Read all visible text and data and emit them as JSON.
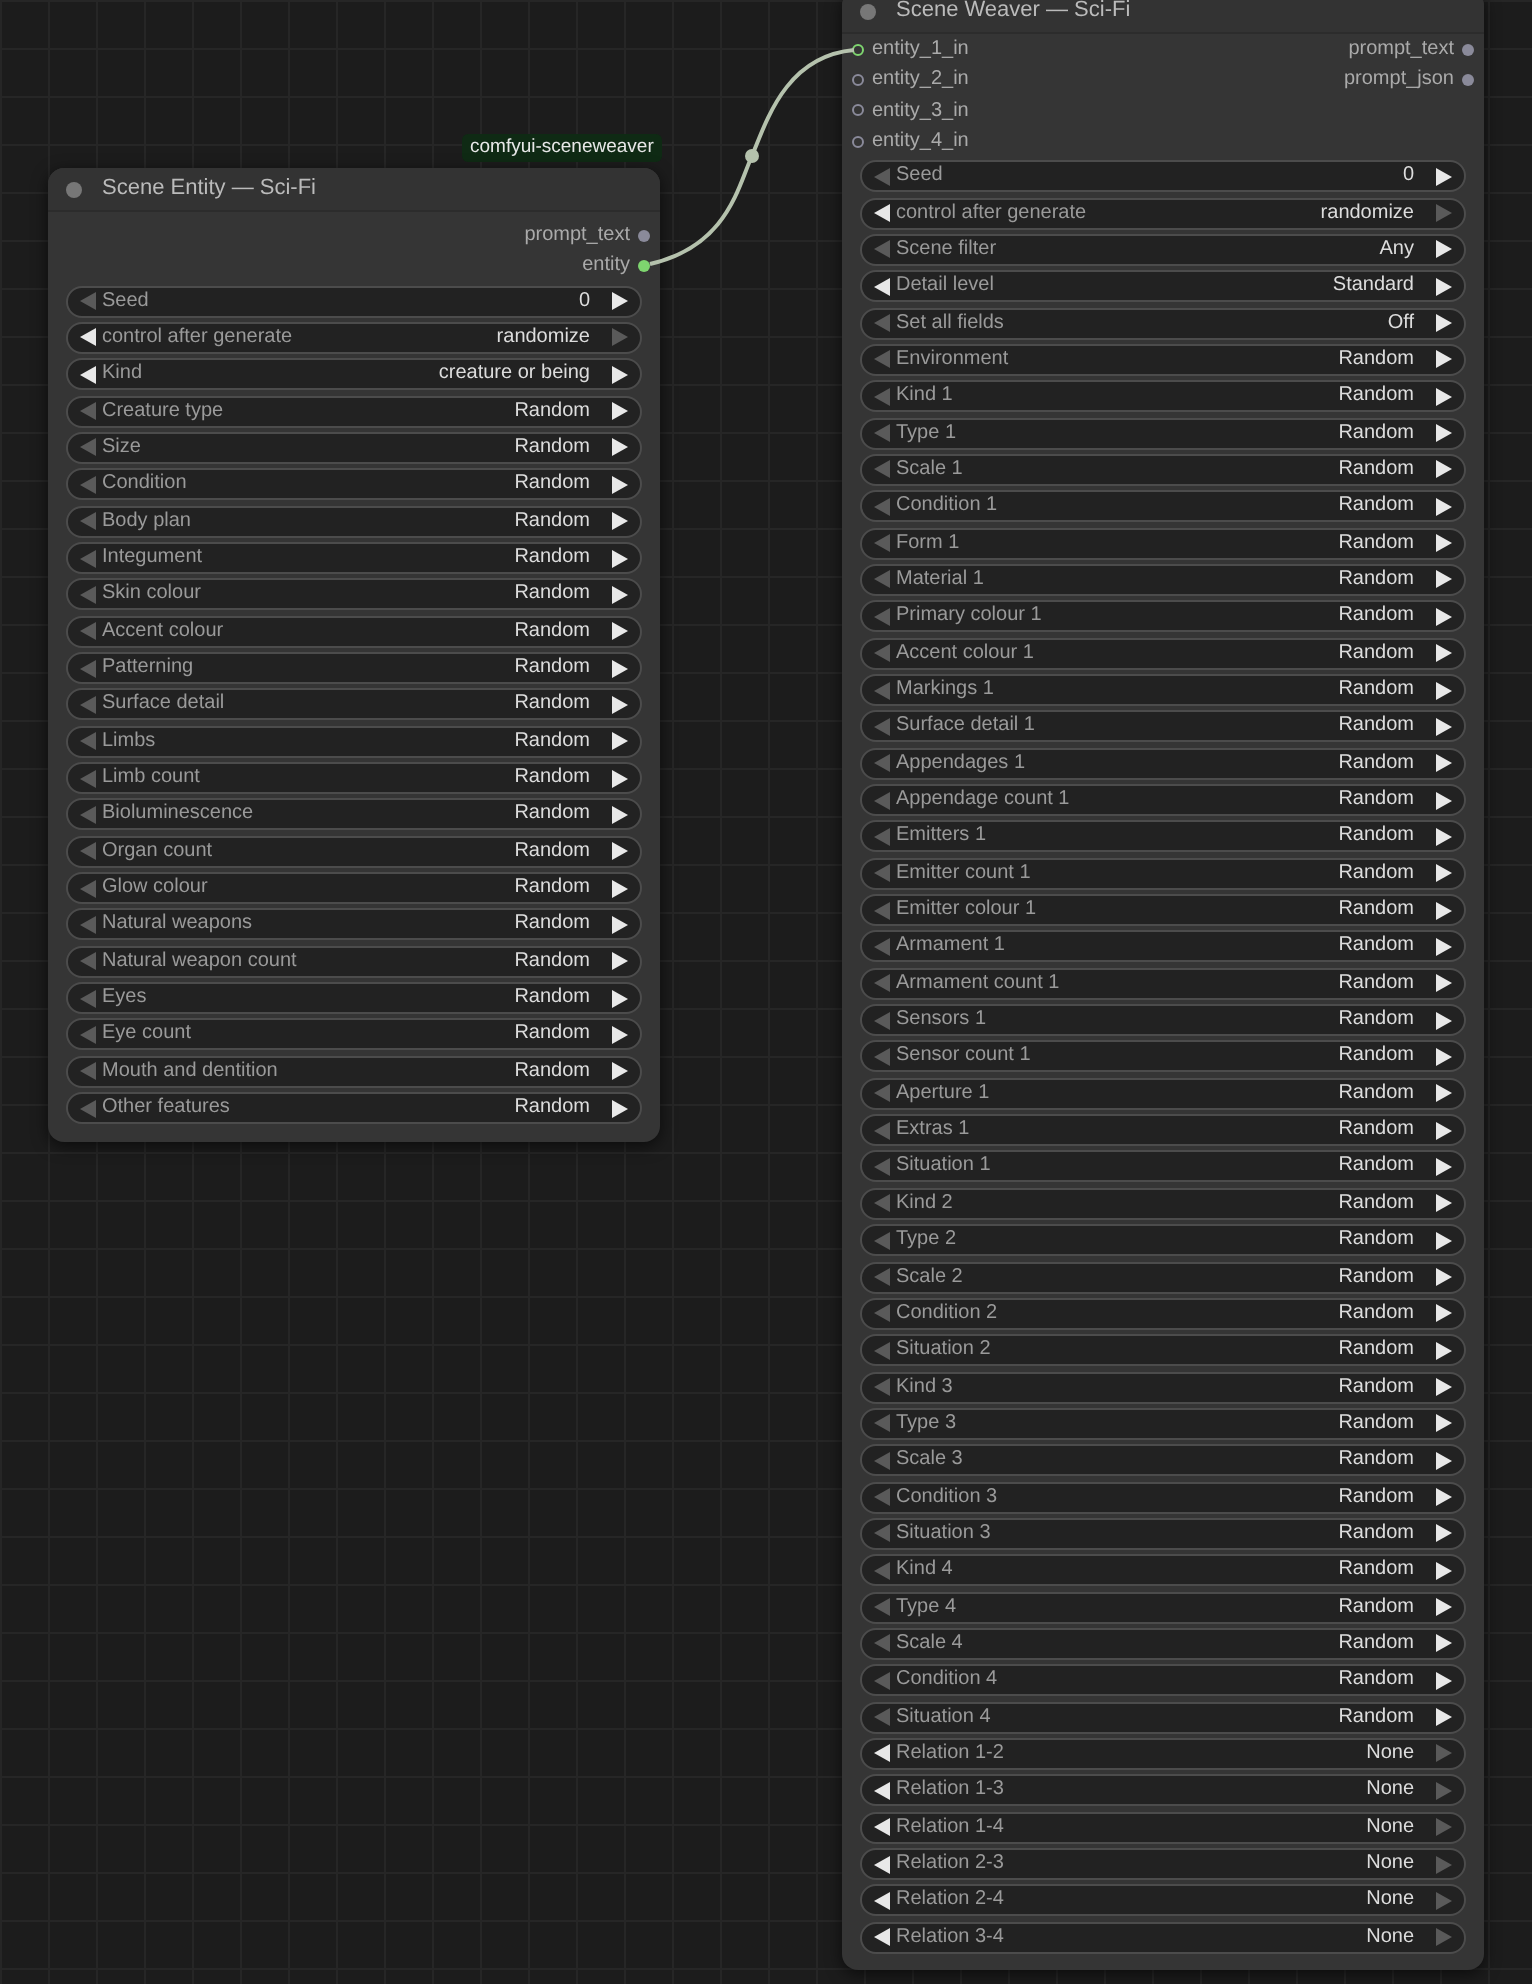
{
  "link_badge": "comfyui-sceneweaver",
  "nodes": [
    {
      "title": "Scene Entity — Sci-Fi",
      "outputs": [
        {
          "name": "prompt_text",
          "connected": false
        },
        {
          "name": "entity",
          "connected": true
        }
      ],
      "widgets": [
        {
          "label": "Seed",
          "value": "0",
          "left_enabled": false,
          "right_enabled": true
        },
        {
          "label": "control after generate",
          "value": "randomize",
          "left_enabled": true,
          "right_enabled": false
        },
        {
          "label": "Kind",
          "value": "creature or being",
          "left_enabled": true,
          "right_enabled": true
        },
        {
          "label": "Creature type",
          "value": "Random",
          "left_enabled": false,
          "right_enabled": true
        },
        {
          "label": "Size",
          "value": "Random",
          "left_enabled": false,
          "right_enabled": true
        },
        {
          "label": "Condition",
          "value": "Random",
          "left_enabled": false,
          "right_enabled": true
        },
        {
          "label": "Body plan",
          "value": "Random",
          "left_enabled": false,
          "right_enabled": true
        },
        {
          "label": "Integument",
          "value": "Random",
          "left_enabled": false,
          "right_enabled": true
        },
        {
          "label": "Skin colour",
          "value": "Random",
          "left_enabled": false,
          "right_enabled": true
        },
        {
          "label": "Accent colour",
          "value": "Random",
          "left_enabled": false,
          "right_enabled": true
        },
        {
          "label": "Patterning",
          "value": "Random",
          "left_enabled": false,
          "right_enabled": true
        },
        {
          "label": "Surface detail",
          "value": "Random",
          "left_enabled": false,
          "right_enabled": true
        },
        {
          "label": "Limbs",
          "value": "Random",
          "left_enabled": false,
          "right_enabled": true
        },
        {
          "label": "Limb count",
          "value": "Random",
          "left_enabled": false,
          "right_enabled": true
        },
        {
          "label": "Bioluminescence",
          "value": "Random",
          "left_enabled": false,
          "right_enabled": true
        },
        {
          "label": "Organ count",
          "value": "Random",
          "left_enabled": false,
          "right_enabled": true
        },
        {
          "label": "Glow colour",
          "value": "Random",
          "left_enabled": false,
          "right_enabled": true
        },
        {
          "label": "Natural weapons",
          "value": "Random",
          "left_enabled": false,
          "right_enabled": true
        },
        {
          "label": "Natural weapon count",
          "value": "Random",
          "left_enabled": false,
          "right_enabled": true
        },
        {
          "label": "Eyes",
          "value": "Random",
          "left_enabled": false,
          "right_enabled": true
        },
        {
          "label": "Eye count",
          "value": "Random",
          "left_enabled": false,
          "right_enabled": true
        },
        {
          "label": "Mouth and dentition",
          "value": "Random",
          "left_enabled": false,
          "right_enabled": true
        },
        {
          "label": "Other features",
          "value": "Random",
          "left_enabled": false,
          "right_enabled": true
        }
      ]
    },
    {
      "title": "Scene Weaver — Sci-Fi",
      "inputs": [
        {
          "name": "entity_1_in",
          "connected": true
        },
        {
          "name": "entity_2_in",
          "connected": false
        },
        {
          "name": "entity_3_in",
          "connected": false
        },
        {
          "name": "entity_4_in",
          "connected": false
        }
      ],
      "outputs": [
        {
          "name": "prompt_text",
          "connected": false
        },
        {
          "name": "prompt_json",
          "connected": false
        }
      ],
      "widgets": [
        {
          "label": "Seed",
          "value": "0",
          "left_enabled": false,
          "right_enabled": true
        },
        {
          "label": "control after generate",
          "value": "randomize",
          "left_enabled": true,
          "right_enabled": false
        },
        {
          "label": "Scene filter",
          "value": "Any",
          "left_enabled": false,
          "right_enabled": true
        },
        {
          "label": "Detail level",
          "value": "Standard",
          "left_enabled": true,
          "right_enabled": true
        },
        {
          "label": "Set all fields",
          "value": "Off",
          "left_enabled": false,
          "right_enabled": true
        },
        {
          "label": "Environment",
          "value": "Random",
          "left_enabled": false,
          "right_enabled": true
        },
        {
          "label": "Kind 1",
          "value": "Random",
          "left_enabled": false,
          "right_enabled": true
        },
        {
          "label": "Type 1",
          "value": "Random",
          "left_enabled": false,
          "right_enabled": true
        },
        {
          "label": "Scale 1",
          "value": "Random",
          "left_enabled": false,
          "right_enabled": true
        },
        {
          "label": "Condition 1",
          "value": "Random",
          "left_enabled": false,
          "right_enabled": true
        },
        {
          "label": "Form 1",
          "value": "Random",
          "left_enabled": false,
          "right_enabled": true
        },
        {
          "label": "Material 1",
          "value": "Random",
          "left_enabled": false,
          "right_enabled": true
        },
        {
          "label": "Primary colour 1",
          "value": "Random",
          "left_enabled": false,
          "right_enabled": true
        },
        {
          "label": "Accent colour 1",
          "value": "Random",
          "left_enabled": false,
          "right_enabled": true
        },
        {
          "label": "Markings 1",
          "value": "Random",
          "left_enabled": false,
          "right_enabled": true
        },
        {
          "label": "Surface detail 1",
          "value": "Random",
          "left_enabled": false,
          "right_enabled": true
        },
        {
          "label": "Appendages 1",
          "value": "Random",
          "left_enabled": false,
          "right_enabled": true
        },
        {
          "label": "Appendage count 1",
          "value": "Random",
          "left_enabled": false,
          "right_enabled": true
        },
        {
          "label": "Emitters 1",
          "value": "Random",
          "left_enabled": false,
          "right_enabled": true
        },
        {
          "label": "Emitter count 1",
          "value": "Random",
          "left_enabled": false,
          "right_enabled": true
        },
        {
          "label": "Emitter colour 1",
          "value": "Random",
          "left_enabled": false,
          "right_enabled": true
        },
        {
          "label": "Armament 1",
          "value": "Random",
          "left_enabled": false,
          "right_enabled": true
        },
        {
          "label": "Armament count 1",
          "value": "Random",
          "left_enabled": false,
          "right_enabled": true
        },
        {
          "label": "Sensors 1",
          "value": "Random",
          "left_enabled": false,
          "right_enabled": true
        },
        {
          "label": "Sensor count 1",
          "value": "Random",
          "left_enabled": false,
          "right_enabled": true
        },
        {
          "label": "Aperture 1",
          "value": "Random",
          "left_enabled": false,
          "right_enabled": true
        },
        {
          "label": "Extras 1",
          "value": "Random",
          "left_enabled": false,
          "right_enabled": true
        },
        {
          "label": "Situation 1",
          "value": "Random",
          "left_enabled": false,
          "right_enabled": true
        },
        {
          "label": "Kind 2",
          "value": "Random",
          "left_enabled": false,
          "right_enabled": true
        },
        {
          "label": "Type 2",
          "value": "Random",
          "left_enabled": false,
          "right_enabled": true
        },
        {
          "label": "Scale 2",
          "value": "Random",
          "left_enabled": false,
          "right_enabled": true
        },
        {
          "label": "Condition 2",
          "value": "Random",
          "left_enabled": false,
          "right_enabled": true
        },
        {
          "label": "Situation 2",
          "value": "Random",
          "left_enabled": false,
          "right_enabled": true
        },
        {
          "label": "Kind 3",
          "value": "Random",
          "left_enabled": false,
          "right_enabled": true
        },
        {
          "label": "Type 3",
          "value": "Random",
          "left_enabled": false,
          "right_enabled": true
        },
        {
          "label": "Scale 3",
          "value": "Random",
          "left_enabled": false,
          "right_enabled": true
        },
        {
          "label": "Condition 3",
          "value": "Random",
          "left_enabled": false,
          "right_enabled": true
        },
        {
          "label": "Situation 3",
          "value": "Random",
          "left_enabled": false,
          "right_enabled": true
        },
        {
          "label": "Kind 4",
          "value": "Random",
          "left_enabled": false,
          "right_enabled": true
        },
        {
          "label": "Type 4",
          "value": "Random",
          "left_enabled": false,
          "right_enabled": true
        },
        {
          "label": "Scale 4",
          "value": "Random",
          "left_enabled": false,
          "right_enabled": true
        },
        {
          "label": "Condition 4",
          "value": "Random",
          "left_enabled": false,
          "right_enabled": true
        },
        {
          "label": "Situation 4",
          "value": "Random",
          "left_enabled": false,
          "right_enabled": true
        },
        {
          "label": "Relation 1-2",
          "value": "None",
          "left_enabled": true,
          "right_enabled": false
        },
        {
          "label": "Relation 1-3",
          "value": "None",
          "left_enabled": true,
          "right_enabled": false
        },
        {
          "label": "Relation 1-4",
          "value": "None",
          "left_enabled": true,
          "right_enabled": false
        },
        {
          "label": "Relation 2-3",
          "value": "None",
          "left_enabled": true,
          "right_enabled": false
        },
        {
          "label": "Relation 2-4",
          "value": "None",
          "left_enabled": true,
          "right_enabled": false
        },
        {
          "label": "Relation 3-4",
          "value": "None",
          "left_enabled": true,
          "right_enabled": false
        }
      ]
    }
  ]
}
